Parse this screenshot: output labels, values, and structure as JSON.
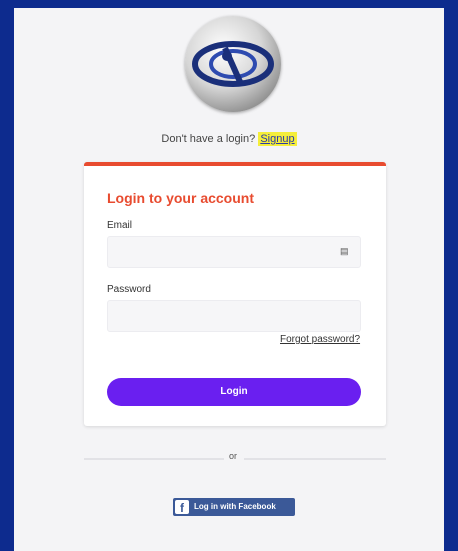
{
  "header": {
    "signup_prompt": "Don't have a login?",
    "signup_link": "Signup"
  },
  "login_card": {
    "title": "Login to your account",
    "email_label": "Email",
    "email_value": "",
    "email_icon": "contact-card-icon",
    "password_label": "Password",
    "password_value": "",
    "forgot_password": "Forgot password?",
    "login_button": "Login"
  },
  "divider": {
    "text": "or"
  },
  "social": {
    "facebook_button": "Log in with Facebook",
    "facebook_icon": "f"
  },
  "colors": {
    "accent": "#e84b2f",
    "primary_button": "#6a1ff0",
    "facebook": "#3b5998",
    "highlight": "#f5ee3a",
    "frame": "#0d2b8e"
  }
}
